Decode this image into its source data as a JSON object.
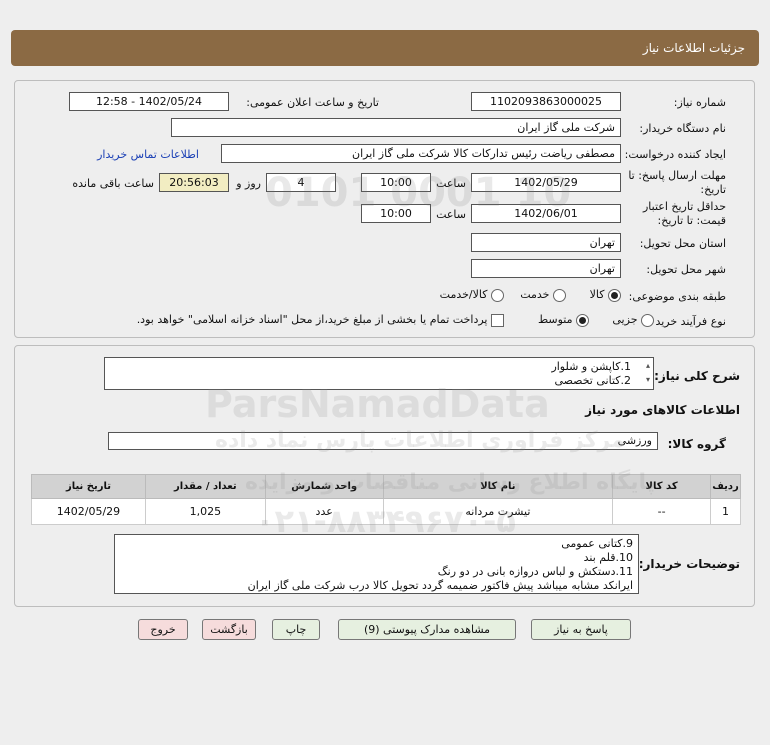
{
  "header": {
    "title": "جزئیات اطلاعات نیاز"
  },
  "form": {
    "need_number_label": "شماره نیاز:",
    "need_number": "1102093863000025",
    "announce_label": "تاریخ و ساعت اعلان عمومی:",
    "announce_value": "1402/05/24 - 12:58",
    "buyer_org_label": "نام دستگاه خریدار:",
    "buyer_org": "شرکت ملی گاز ایران",
    "creator_label": "ایجاد کننده درخواست:",
    "creator": "مصطفی ریاضت رئیس تدارکات کالا شرکت ملی گاز ایران",
    "contact_link": "اطلاعات تماس خریدار",
    "reply_deadline_label_1": "مهلت ارسال پاسخ: تا",
    "reply_deadline_label_2": "تاریخ:",
    "reply_date": "1402/05/29",
    "time_label": "ساعت",
    "reply_time": "10:00",
    "days_value": "4",
    "days_label": "روز و",
    "remaining_time": "20:56:03",
    "remaining_label": "ساعت باقی مانده",
    "validity_label_1": "حداقل تاریخ اعتبار",
    "validity_label_2": "قیمت: تا تاریخ:",
    "validity_date": "1402/06/01",
    "validity_time_label": "ساعت",
    "validity_time": "10:00",
    "province_label": "استان محل تحویل:",
    "province": "تهران",
    "city_label": "شهر محل تحویل:",
    "city": "تهران",
    "category_label": "طبقه بندی موضوعی:",
    "category_options": [
      "کالا",
      "خدمت",
      "کالا/خدمت"
    ],
    "process_label": "نوع فرآیند خرید :",
    "process_options": [
      "جزیی",
      "متوسط"
    ],
    "payment_note": "پرداخت تمام یا بخشی از مبلغ خرید،از محل \"اسناد خزانه اسلامی\" خواهد بود."
  },
  "details": {
    "summary_label": "شرح کلی نیاز:",
    "summary_lines": [
      "1.کاپشن و شلوار",
      "2.کتانی تخصصی"
    ],
    "goods_info_title": "اطلاعات کالاهای مورد نیاز",
    "goods_group_label": "گروه کالا:",
    "goods_group": "ورزشی",
    "table_headers": [
      "ردیف",
      "کد کالا",
      "نام کالا",
      "واحد شمارش",
      "تعداد / مقدار",
      "تاریخ نیاز"
    ],
    "table_rows": [
      {
        "row": "1",
        "code": "--",
        "name": "تیشرت مردانه",
        "unit": "عدد",
        "qty": "1,025",
        "date": "1402/05/29"
      }
    ],
    "buyer_notes_label": "توضیحات خریدار:",
    "buyer_notes_lines": [
      "9.کتانی عمومی",
      "10.قلم بند",
      "11.دستکش و لباس دروازه بانی در دو رنگ",
      "ایرانکد مشابه میباشد پیش فاکتور ضمیمه گردد تحویل کالا درب شرکت ملی گاز ایران"
    ]
  },
  "buttons": {
    "reply": "پاسخ به نیاز",
    "attachments": "مشاهده مدارک پیوستی (9)",
    "print": "چاپ",
    "back": "بازگشت",
    "exit": "خروج"
  },
  "watermark": {
    "brand": "ParsNamadData",
    "line1": "مرکز فراوری اطلاعات پارس نماد داده",
    "line2": "پایگاه اطلاع رسانی مناقصات و مزایده",
    "phone": "۰۲۱-۸۸۳۴۹۶۷۰-۵",
    "stamp": "0101 0001 10"
  },
  "colors": {
    "titlebar": "#8b6a44",
    "link": "#1a3fb5",
    "highlight": "#f2edc2"
  }
}
